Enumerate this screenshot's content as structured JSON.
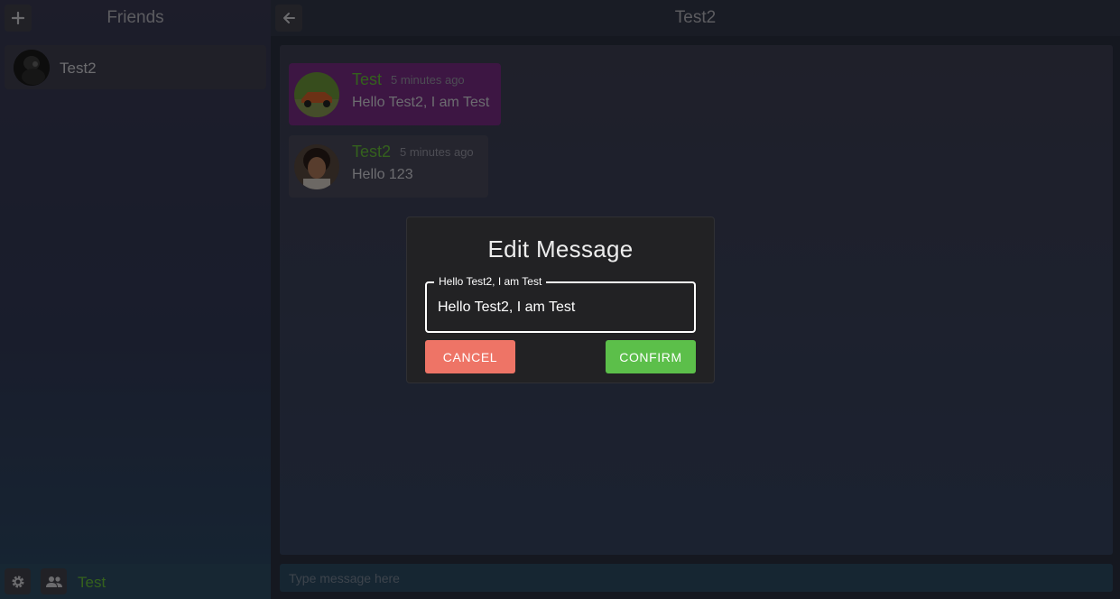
{
  "sidebar": {
    "title": "Friends",
    "add_icon": "plus-icon",
    "friends": [
      {
        "name": "Test2"
      }
    ],
    "footer": {
      "settings_icon": "gear-icon",
      "friends_icon": "people-icon",
      "username": "Test"
    }
  },
  "chat": {
    "title": "Test2",
    "back_icon": "arrow-left-icon",
    "messages": [
      {
        "author": "Test",
        "time": "5 minutes ago",
        "text": "Hello Test2, I am Test",
        "bubble_color": "#7a2c86"
      },
      {
        "author": "Test2",
        "time": "5 minutes ago",
        "text": "Hello 123",
        "bubble_color": "#4a4a5c"
      }
    ],
    "composer_placeholder": "Type message here"
  },
  "dialog": {
    "title": "Edit Message",
    "field_label": "Hello Test2, I am Test",
    "field_value": "Hello Test2, I am Test",
    "cancel_label": "CANCEL",
    "confirm_label": "CONFIRM"
  },
  "colors": {
    "accent_green": "#69c23a",
    "cancel_red": "#ee7466",
    "confirm_green": "#5cbf4a"
  }
}
